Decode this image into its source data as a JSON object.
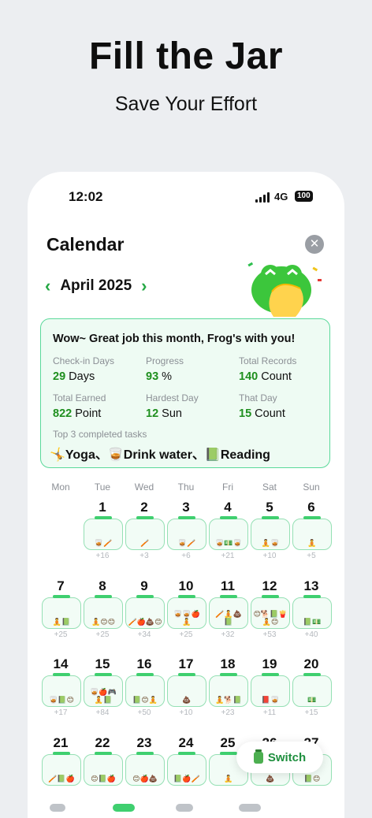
{
  "promo": {
    "title": "Fill the Jar",
    "subtitle": "Save Your Effort"
  },
  "status_bar": {
    "time": "12:02",
    "network": "4G",
    "battery": "100"
  },
  "calendar": {
    "title": "Calendar",
    "month": "April 2025",
    "summary": {
      "message": "Wow~ Great job this month, Frog's with you!",
      "stats": [
        {
          "label": "Check-in Days",
          "value": "29",
          "unit": "Days"
        },
        {
          "label": "Progress",
          "value": "93",
          "unit": "%"
        },
        {
          "label": "Total Records",
          "value": "140",
          "unit": "Count"
        },
        {
          "label": "Total Earned",
          "value": "822",
          "unit": "Point"
        },
        {
          "label": "Hardest Day",
          "value": "12",
          "unit": "Sun"
        },
        {
          "label": "That Day",
          "value": "15",
          "unit": "Count"
        }
      ],
      "top_label": "Top 3 completed tasks",
      "top_tasks": "🤸Yoga、🥃Drink water、📗Reading"
    },
    "weekdays": [
      "Mon",
      "Tue",
      "Wed",
      "Thu",
      "Fri",
      "Sat",
      "Sun"
    ],
    "days": [
      {
        "d": "1",
        "emo": "🥃🪥",
        "cnt": "+16"
      },
      {
        "d": "2",
        "emo": "🪥",
        "cnt": "+3"
      },
      {
        "d": "3",
        "emo": "🥃🪥",
        "cnt": "+6"
      },
      {
        "d": "4",
        "emo": "🥃💵🥃",
        "cnt": "+21"
      },
      {
        "d": "5",
        "emo": "🧘🥃",
        "cnt": "+10"
      },
      {
        "d": "6",
        "emo": "🧘",
        "cnt": "+5"
      },
      {
        "d": "7",
        "emo": "🧘📗",
        "cnt": "+25"
      },
      {
        "d": "8",
        "emo": "🧘😊😊",
        "cnt": "+25"
      },
      {
        "d": "9",
        "emo": "🪥🍎💩😊",
        "cnt": "+34"
      },
      {
        "d": "10",
        "emo": "🥃🥃🍎🧘",
        "cnt": "+25"
      },
      {
        "d": "11",
        "emo": "🪥🧘💩📗",
        "cnt": "+32"
      },
      {
        "d": "12",
        "emo": "😊🐕📗🍟🧘😊",
        "cnt": "+53"
      },
      {
        "d": "13",
        "emo": "📗💵",
        "cnt": "+40"
      },
      {
        "d": "14",
        "emo": "🥃📗😊",
        "cnt": "+17"
      },
      {
        "d": "15",
        "emo": "🥃🍎🎮🧘📗",
        "cnt": "+84"
      },
      {
        "d": "16",
        "emo": "📗😊🧘",
        "cnt": "+50"
      },
      {
        "d": "17",
        "emo": "💩",
        "cnt": "+10"
      },
      {
        "d": "18",
        "emo": "🧘🐕📗",
        "cnt": "+23"
      },
      {
        "d": "19",
        "emo": "📕🥃",
        "cnt": "+11"
      },
      {
        "d": "20",
        "emo": "💵",
        "cnt": "+15"
      },
      {
        "d": "21",
        "emo": "🪥📗🍎",
        "cnt": ""
      },
      {
        "d": "22",
        "emo": "😊📗🍎",
        "cnt": ""
      },
      {
        "d": "23",
        "emo": "😊🍎💩",
        "cnt": ""
      },
      {
        "d": "24",
        "emo": "📗🍎🪥",
        "cnt": ""
      },
      {
        "d": "25",
        "emo": "🧘",
        "cnt": ""
      },
      {
        "d": "26",
        "emo": "💩",
        "cnt": ""
      },
      {
        "d": "27",
        "emo": "📗😊",
        "cnt": ""
      }
    ],
    "switch_label": "Switch"
  }
}
